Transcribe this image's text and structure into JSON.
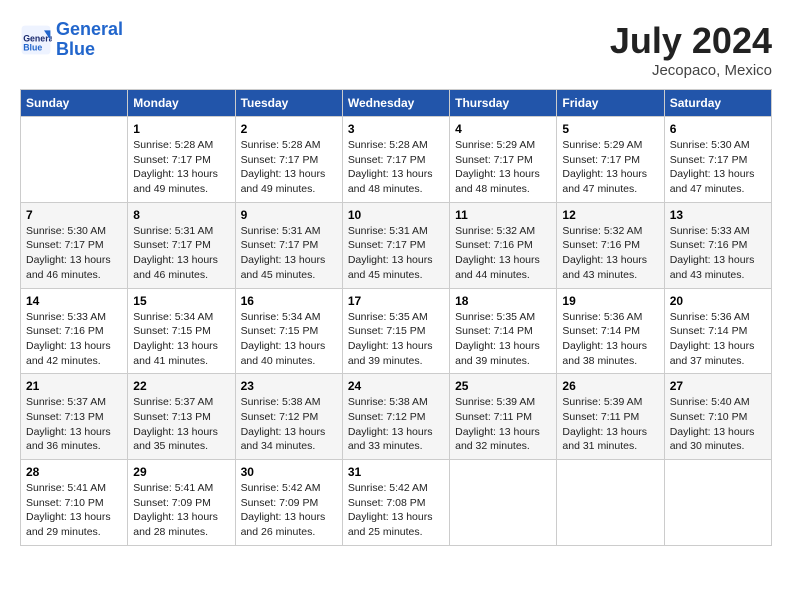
{
  "header": {
    "logo_line1": "General",
    "logo_line2": "Blue",
    "month": "July 2024",
    "location": "Jecopaco, Mexico"
  },
  "days_of_week": [
    "Sunday",
    "Monday",
    "Tuesday",
    "Wednesday",
    "Thursday",
    "Friday",
    "Saturday"
  ],
  "weeks": [
    [
      {
        "day": "",
        "info": ""
      },
      {
        "day": "1",
        "info": "Sunrise: 5:28 AM\nSunset: 7:17 PM\nDaylight: 13 hours\nand 49 minutes."
      },
      {
        "day": "2",
        "info": "Sunrise: 5:28 AM\nSunset: 7:17 PM\nDaylight: 13 hours\nand 49 minutes."
      },
      {
        "day": "3",
        "info": "Sunrise: 5:28 AM\nSunset: 7:17 PM\nDaylight: 13 hours\nand 48 minutes."
      },
      {
        "day": "4",
        "info": "Sunrise: 5:29 AM\nSunset: 7:17 PM\nDaylight: 13 hours\nand 48 minutes."
      },
      {
        "day": "5",
        "info": "Sunrise: 5:29 AM\nSunset: 7:17 PM\nDaylight: 13 hours\nand 47 minutes."
      },
      {
        "day": "6",
        "info": "Sunrise: 5:30 AM\nSunset: 7:17 PM\nDaylight: 13 hours\nand 47 minutes."
      }
    ],
    [
      {
        "day": "7",
        "info": "Sunrise: 5:30 AM\nSunset: 7:17 PM\nDaylight: 13 hours\nand 46 minutes."
      },
      {
        "day": "8",
        "info": "Sunrise: 5:31 AM\nSunset: 7:17 PM\nDaylight: 13 hours\nand 46 minutes."
      },
      {
        "day": "9",
        "info": "Sunrise: 5:31 AM\nSunset: 7:17 PM\nDaylight: 13 hours\nand 45 minutes."
      },
      {
        "day": "10",
        "info": "Sunrise: 5:31 AM\nSunset: 7:17 PM\nDaylight: 13 hours\nand 45 minutes."
      },
      {
        "day": "11",
        "info": "Sunrise: 5:32 AM\nSunset: 7:16 PM\nDaylight: 13 hours\nand 44 minutes."
      },
      {
        "day": "12",
        "info": "Sunrise: 5:32 AM\nSunset: 7:16 PM\nDaylight: 13 hours\nand 43 minutes."
      },
      {
        "day": "13",
        "info": "Sunrise: 5:33 AM\nSunset: 7:16 PM\nDaylight: 13 hours\nand 43 minutes."
      }
    ],
    [
      {
        "day": "14",
        "info": "Sunrise: 5:33 AM\nSunset: 7:16 PM\nDaylight: 13 hours\nand 42 minutes."
      },
      {
        "day": "15",
        "info": "Sunrise: 5:34 AM\nSunset: 7:15 PM\nDaylight: 13 hours\nand 41 minutes."
      },
      {
        "day": "16",
        "info": "Sunrise: 5:34 AM\nSunset: 7:15 PM\nDaylight: 13 hours\nand 40 minutes."
      },
      {
        "day": "17",
        "info": "Sunrise: 5:35 AM\nSunset: 7:15 PM\nDaylight: 13 hours\nand 39 minutes."
      },
      {
        "day": "18",
        "info": "Sunrise: 5:35 AM\nSunset: 7:14 PM\nDaylight: 13 hours\nand 39 minutes."
      },
      {
        "day": "19",
        "info": "Sunrise: 5:36 AM\nSunset: 7:14 PM\nDaylight: 13 hours\nand 38 minutes."
      },
      {
        "day": "20",
        "info": "Sunrise: 5:36 AM\nSunset: 7:14 PM\nDaylight: 13 hours\nand 37 minutes."
      }
    ],
    [
      {
        "day": "21",
        "info": "Sunrise: 5:37 AM\nSunset: 7:13 PM\nDaylight: 13 hours\nand 36 minutes."
      },
      {
        "day": "22",
        "info": "Sunrise: 5:37 AM\nSunset: 7:13 PM\nDaylight: 13 hours\nand 35 minutes."
      },
      {
        "day": "23",
        "info": "Sunrise: 5:38 AM\nSunset: 7:12 PM\nDaylight: 13 hours\nand 34 minutes."
      },
      {
        "day": "24",
        "info": "Sunrise: 5:38 AM\nSunset: 7:12 PM\nDaylight: 13 hours\nand 33 minutes."
      },
      {
        "day": "25",
        "info": "Sunrise: 5:39 AM\nSunset: 7:11 PM\nDaylight: 13 hours\nand 32 minutes."
      },
      {
        "day": "26",
        "info": "Sunrise: 5:39 AM\nSunset: 7:11 PM\nDaylight: 13 hours\nand 31 minutes."
      },
      {
        "day": "27",
        "info": "Sunrise: 5:40 AM\nSunset: 7:10 PM\nDaylight: 13 hours\nand 30 minutes."
      }
    ],
    [
      {
        "day": "28",
        "info": "Sunrise: 5:41 AM\nSunset: 7:10 PM\nDaylight: 13 hours\nand 29 minutes."
      },
      {
        "day": "29",
        "info": "Sunrise: 5:41 AM\nSunset: 7:09 PM\nDaylight: 13 hours\nand 28 minutes."
      },
      {
        "day": "30",
        "info": "Sunrise: 5:42 AM\nSunset: 7:09 PM\nDaylight: 13 hours\nand 26 minutes."
      },
      {
        "day": "31",
        "info": "Sunrise: 5:42 AM\nSunset: 7:08 PM\nDaylight: 13 hours\nand 25 minutes."
      },
      {
        "day": "",
        "info": ""
      },
      {
        "day": "",
        "info": ""
      },
      {
        "day": "",
        "info": ""
      }
    ]
  ]
}
